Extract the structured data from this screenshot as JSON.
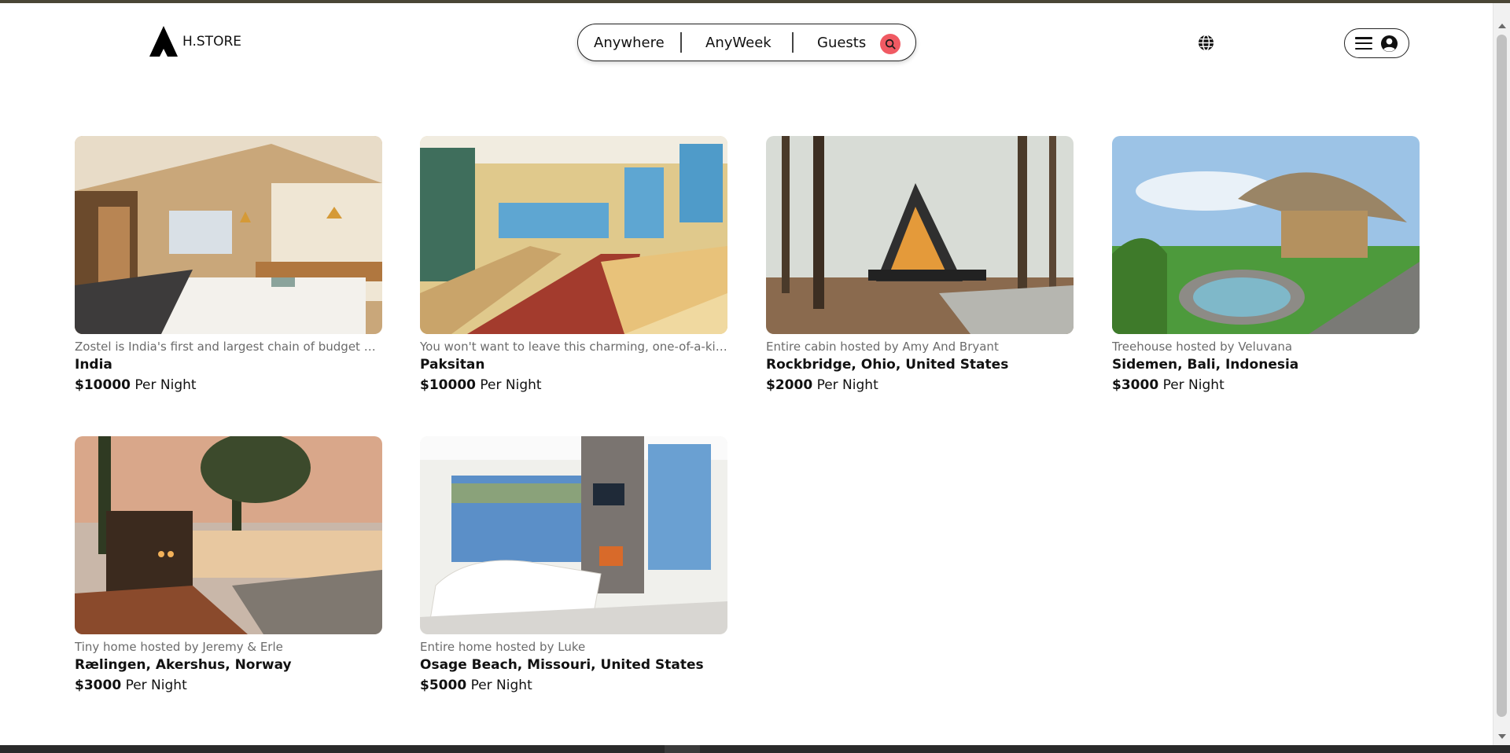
{
  "header": {
    "logo_text": "H.STORE",
    "search": {
      "anywhere": "Anywhere",
      "week": "AnyWeek",
      "guests": "Guests",
      "search_icon": "search-icon"
    },
    "icons": {
      "globe": "globe-icon",
      "menu": "hamburger-icon",
      "user": "user-circle-icon"
    },
    "accent_color": "#f05a63"
  },
  "listings": [
    {
      "description": "Zostel is India's first and largest chain of budget hostels",
      "location": "India",
      "price": "$10000",
      "price_suffix": "Per Night"
    },
    {
      "description": "You won't want to leave this charming, one-of-a-kind space",
      "location": "Paksitan",
      "price": "$10000",
      "price_suffix": "Per Night"
    },
    {
      "description": "Entire cabin hosted by Amy And Bryant",
      "location": "Rockbridge, Ohio, United States",
      "price": "$2000",
      "price_suffix": "Per Night"
    },
    {
      "description": "Treehouse hosted by Veluvana",
      "location": "Sidemen, Bali, Indonesia",
      "price": "$3000",
      "price_suffix": "Per Night"
    },
    {
      "description": "Tiny home hosted by Jeremy & Erle",
      "location": "Rælingen, Akershus, Norway",
      "price": "$3000",
      "price_suffix": "Per Night"
    },
    {
      "description": "Entire home hosted by Luke",
      "location": "Osage Beach, Missouri, United States",
      "price": "$5000",
      "price_suffix": "Per Night"
    }
  ]
}
